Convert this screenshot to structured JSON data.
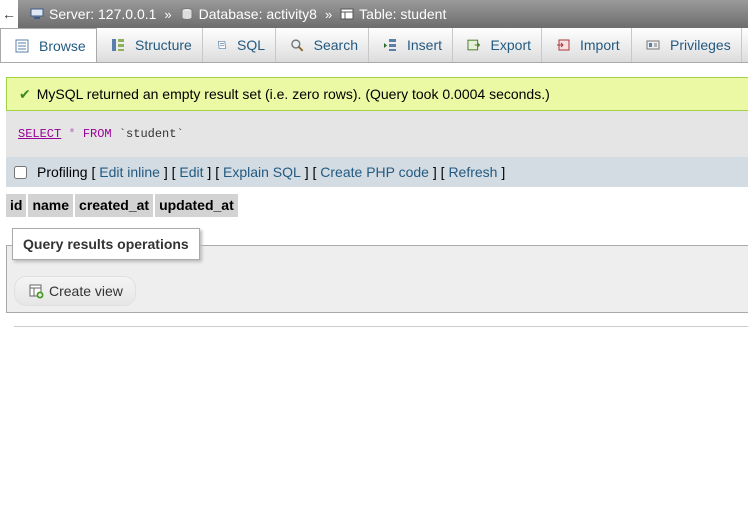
{
  "breadcrumb": {
    "back": "←",
    "server": "Server: 127.0.0.1",
    "database": "Database: activity8",
    "table": "Table: student",
    "separator": "»"
  },
  "tabs": [
    {
      "label": "Browse",
      "icon": "browse-icon"
    },
    {
      "label": "Structure",
      "icon": "structure-icon"
    },
    {
      "label": "SQL",
      "icon": "sql-icon"
    },
    {
      "label": "Search",
      "icon": "search-icon"
    },
    {
      "label": "Insert",
      "icon": "insert-icon"
    },
    {
      "label": "Export",
      "icon": "export-icon"
    },
    {
      "label": "Import",
      "icon": "import-icon"
    },
    {
      "label": "Privileges",
      "icon": "privileges-icon"
    }
  ],
  "message": "MySQL returned an empty result set (i.e. zero rows). (Query took 0.0004 seconds.)",
  "sql": {
    "select": "SELECT",
    "star": "*",
    "from": "FROM",
    "table": "`student`"
  },
  "profiling": {
    "label": "Profiling",
    "links": [
      "Edit inline",
      "Edit",
      "Explain SQL",
      "Create PHP code",
      "Refresh"
    ]
  },
  "columns": [
    "id",
    "name",
    "created_at",
    "updated_at"
  ],
  "operations": {
    "legend": "Query results operations",
    "create_view": "Create view"
  },
  "colors": {
    "accent": "#235a81",
    "success_bg": "#ebf8a4",
    "success_border": "#a2d246"
  }
}
